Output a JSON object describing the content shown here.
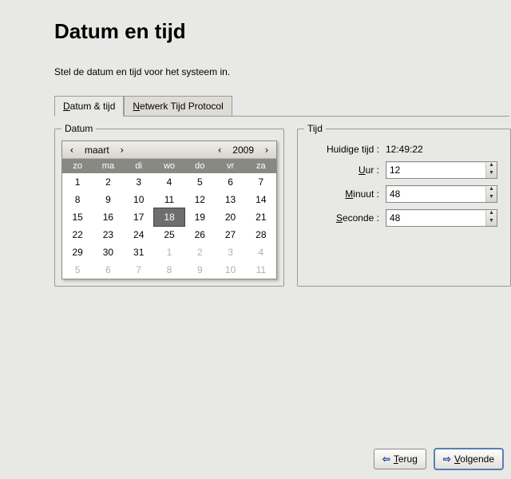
{
  "title": "Datum en tijd",
  "subtitle": "Stel de datum en tijd voor het systeem in.",
  "tabs": [
    {
      "label_pre": "",
      "u": "D",
      "label_post": "atum & tijd",
      "active": true
    },
    {
      "label_pre": "",
      "u": "N",
      "label_post": "etwerk Tijd Protocol",
      "active": false
    }
  ],
  "date": {
    "legend": "Datum",
    "month": "maart",
    "year": "2009",
    "daynames": [
      "zo",
      "ma",
      "di",
      "wo",
      "do",
      "vr",
      "za"
    ],
    "cells": [
      {
        "t": "1"
      },
      {
        "t": "2"
      },
      {
        "t": "3"
      },
      {
        "t": "4"
      },
      {
        "t": "5"
      },
      {
        "t": "6"
      },
      {
        "t": "7"
      },
      {
        "t": "8"
      },
      {
        "t": "9"
      },
      {
        "t": "10"
      },
      {
        "t": "11"
      },
      {
        "t": "12"
      },
      {
        "t": "13"
      },
      {
        "t": "14"
      },
      {
        "t": "15"
      },
      {
        "t": "16"
      },
      {
        "t": "17"
      },
      {
        "t": "18",
        "sel": true
      },
      {
        "t": "19"
      },
      {
        "t": "20"
      },
      {
        "t": "21"
      },
      {
        "t": "22"
      },
      {
        "t": "23"
      },
      {
        "t": "24"
      },
      {
        "t": "25"
      },
      {
        "t": "26"
      },
      {
        "t": "27"
      },
      {
        "t": "28"
      },
      {
        "t": "29"
      },
      {
        "t": "30"
      },
      {
        "t": "31"
      },
      {
        "t": "1",
        "other": true
      },
      {
        "t": "2",
        "other": true
      },
      {
        "t": "3",
        "other": true
      },
      {
        "t": "4",
        "other": true
      },
      {
        "t": "5",
        "other": true
      },
      {
        "t": "6",
        "other": true
      },
      {
        "t": "7",
        "other": true
      },
      {
        "t": "8",
        "other": true
      },
      {
        "t": "9",
        "other": true
      },
      {
        "t": "10",
        "other": true
      },
      {
        "t": "11",
        "other": true
      }
    ]
  },
  "time": {
    "legend": "Tijd",
    "current_label": "Huidige tijd :",
    "current_value": "12:49:22",
    "hour_u": "U",
    "hour_post": "ur :",
    "hour_value": "12",
    "minute_u": "M",
    "minute_post": "inuut :",
    "minute_value": "48",
    "second_u": "S",
    "second_post": "econde :",
    "second_value": "48"
  },
  "buttons": {
    "back_u": "T",
    "back_post": "erug",
    "next_u": "V",
    "next_post": "olgende"
  }
}
